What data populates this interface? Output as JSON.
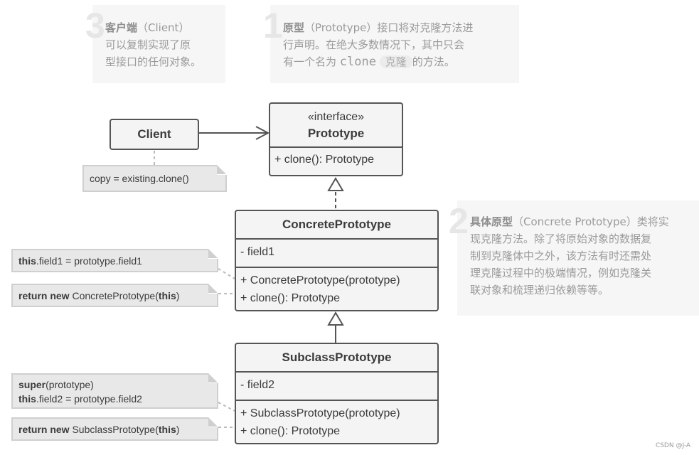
{
  "callouts": [
    {
      "number": "3",
      "title": "客户端",
      "title_en": "（Client）",
      "lines": [
        "可以复制实现了原",
        "型接口的任何对象。"
      ]
    },
    {
      "number": "1",
      "title": "原型",
      "title_en": "（Prototype）",
      "line1_rest": "接口将对克隆方法进",
      "line2": "行声明。在绝大多数情况下，其中只会",
      "line3_pre": "有一个名为",
      "line3_code": "clone",
      "line3_pill": "克隆",
      "line3_post": "的方法。"
    },
    {
      "number": "2",
      "title": "具体原型",
      "title_en": "（Concrete Prototype）",
      "line1_rest": "类将实",
      "lines": [
        "现克隆方法。除了将原始对象的数据复",
        "制到克隆体中之外，该方法有时还需处",
        "理克隆过程中的极端情况，例如克隆关",
        "联对象和梳理递归依赖等等。"
      ]
    }
  ],
  "classes": {
    "client": {
      "name": "Client"
    },
    "prototype": {
      "stereotype": "«interface»",
      "name": "Prototype",
      "methods": [
        "+ clone(): Prototype"
      ]
    },
    "concrete": {
      "name": "ConcretePrototype",
      "fields": [
        "- field1"
      ],
      "methods": [
        "+ ConcretePrototype(prototype)",
        "+ clone(): Prototype"
      ]
    },
    "subclass": {
      "name": "SubclassPrototype",
      "fields": [
        "- field2"
      ],
      "methods": [
        "+ SubclassPrototype(prototype)",
        "+ clone(): Prototype"
      ]
    }
  },
  "notes": {
    "client_note": "copy = existing.clone()",
    "concrete_ctor": {
      "kw": "this",
      "rest": ".field1 = prototype.field1"
    },
    "concrete_clone": {
      "kw": "return new",
      "mid": " ConcretePrototype(",
      "kw2": "this",
      "end": ")"
    },
    "sub_ctor_line1": {
      "kw": "super",
      "rest": "(prototype)"
    },
    "sub_ctor_line2": {
      "kw": "this",
      "rest": ".field2 = prototype.field2"
    },
    "sub_clone": {
      "kw": "return new",
      "mid": " SubclassPrototype(",
      "kw2": "this",
      "end": ")"
    }
  },
  "watermark": "CSDN @J-A"
}
